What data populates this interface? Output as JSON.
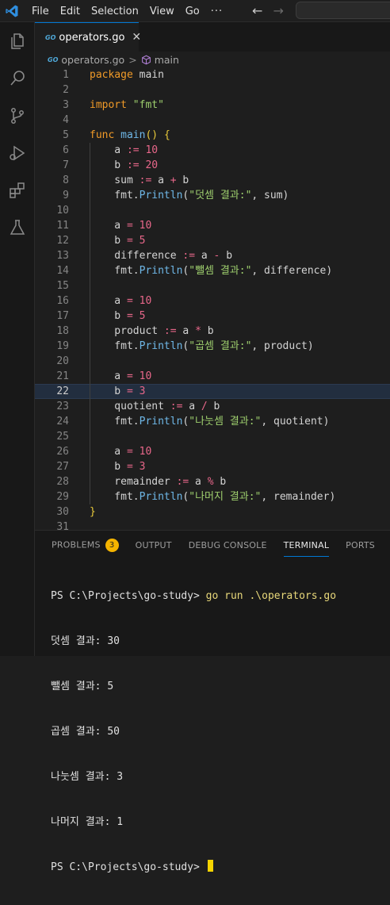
{
  "menu": {
    "items": [
      "File",
      "Edit",
      "Selection",
      "View",
      "Go"
    ],
    "more": "···"
  },
  "nav": {
    "back": "←",
    "forward": "→"
  },
  "tab": {
    "icon": "GO",
    "filename": "operators.go",
    "close": "✕"
  },
  "breadcrumb": {
    "icon": "GO",
    "file": "operators.go",
    "separator": ">",
    "symbol": "main"
  },
  "code": {
    "highlighted_line": 22,
    "lines": [
      {
        "n": "1",
        "tokens": [
          [
            "k",
            "package"
          ],
          [
            "v",
            " "
          ],
          [
            "v",
            "main"
          ]
        ]
      },
      {
        "n": "2",
        "tokens": []
      },
      {
        "n": "3",
        "tokens": [
          [
            "k",
            "import"
          ],
          [
            "v",
            " "
          ],
          [
            "s",
            "\"fmt\""
          ]
        ]
      },
      {
        "n": "4",
        "tokens": []
      },
      {
        "n": "5",
        "tokens": [
          [
            "k",
            "func"
          ],
          [
            "v",
            " "
          ],
          [
            "f",
            "main"
          ],
          [
            "b",
            "()"
          ],
          [
            "v",
            " "
          ],
          [
            "b",
            "{"
          ]
        ]
      },
      {
        "n": "6",
        "tokens": [
          [
            "v",
            "    a "
          ],
          [
            "o",
            ":="
          ],
          [
            "v",
            " "
          ],
          [
            "n",
            "10"
          ]
        ]
      },
      {
        "n": "7",
        "tokens": [
          [
            "v",
            "    b "
          ],
          [
            "o",
            ":="
          ],
          [
            "v",
            " "
          ],
          [
            "n",
            "20"
          ]
        ]
      },
      {
        "n": "8",
        "tokens": [
          [
            "v",
            "    sum "
          ],
          [
            "o",
            ":="
          ],
          [
            "v",
            " a "
          ],
          [
            "o",
            "+"
          ],
          [
            "v",
            " b"
          ]
        ]
      },
      {
        "n": "9",
        "tokens": [
          [
            "v",
            "    fmt."
          ],
          [
            "f",
            "Println"
          ],
          [
            "v",
            "("
          ],
          [
            "s",
            "\"덧셈 결과:\""
          ],
          [
            "v",
            ", sum)"
          ]
        ]
      },
      {
        "n": "10",
        "tokens": []
      },
      {
        "n": "11",
        "tokens": [
          [
            "v",
            "    a "
          ],
          [
            "o",
            "="
          ],
          [
            "v",
            " "
          ],
          [
            "n",
            "10"
          ]
        ]
      },
      {
        "n": "12",
        "tokens": [
          [
            "v",
            "    b "
          ],
          [
            "o",
            "="
          ],
          [
            "v",
            " "
          ],
          [
            "n",
            "5"
          ]
        ]
      },
      {
        "n": "13",
        "tokens": [
          [
            "v",
            "    difference "
          ],
          [
            "o",
            ":="
          ],
          [
            "v",
            " a "
          ],
          [
            "o",
            "-"
          ],
          [
            "v",
            " b"
          ]
        ]
      },
      {
        "n": "14",
        "tokens": [
          [
            "v",
            "    fmt."
          ],
          [
            "f",
            "Println"
          ],
          [
            "v",
            "("
          ],
          [
            "s",
            "\"뺄셈 결과:\""
          ],
          [
            "v",
            ", difference)"
          ]
        ]
      },
      {
        "n": "15",
        "tokens": []
      },
      {
        "n": "16",
        "tokens": [
          [
            "v",
            "    a "
          ],
          [
            "o",
            "="
          ],
          [
            "v",
            " "
          ],
          [
            "n",
            "10"
          ]
        ]
      },
      {
        "n": "17",
        "tokens": [
          [
            "v",
            "    b "
          ],
          [
            "o",
            "="
          ],
          [
            "v",
            " "
          ],
          [
            "n",
            "5"
          ]
        ]
      },
      {
        "n": "18",
        "tokens": [
          [
            "v",
            "    product "
          ],
          [
            "o",
            ":="
          ],
          [
            "v",
            " a "
          ],
          [
            "o",
            "*"
          ],
          [
            "v",
            " b"
          ]
        ]
      },
      {
        "n": "19",
        "tokens": [
          [
            "v",
            "    fmt."
          ],
          [
            "f",
            "Println"
          ],
          [
            "v",
            "("
          ],
          [
            "s",
            "\"곱셈 결과:\""
          ],
          [
            "v",
            ", product)"
          ]
        ]
      },
      {
        "n": "20",
        "tokens": []
      },
      {
        "n": "21",
        "tokens": [
          [
            "v",
            "    a "
          ],
          [
            "o",
            "="
          ],
          [
            "v",
            " "
          ],
          [
            "n",
            "10"
          ]
        ]
      },
      {
        "n": "22",
        "tokens": [
          [
            "v",
            "    b "
          ],
          [
            "o",
            "="
          ],
          [
            "v",
            " "
          ],
          [
            "n",
            "3"
          ]
        ]
      },
      {
        "n": "23",
        "tokens": [
          [
            "v",
            "    quotient "
          ],
          [
            "o",
            ":="
          ],
          [
            "v",
            " a "
          ],
          [
            "o",
            "/"
          ],
          [
            "v",
            " b"
          ]
        ]
      },
      {
        "n": "24",
        "tokens": [
          [
            "v",
            "    fmt."
          ],
          [
            "f",
            "Println"
          ],
          [
            "v",
            "("
          ],
          [
            "s",
            "\"나눗셈 결과:\""
          ],
          [
            "v",
            ", quotient)"
          ]
        ]
      },
      {
        "n": "25",
        "tokens": []
      },
      {
        "n": "26",
        "tokens": [
          [
            "v",
            "    a "
          ],
          [
            "o",
            "="
          ],
          [
            "v",
            " "
          ],
          [
            "n",
            "10"
          ]
        ]
      },
      {
        "n": "27",
        "tokens": [
          [
            "v",
            "    b "
          ],
          [
            "o",
            "="
          ],
          [
            "v",
            " "
          ],
          [
            "n",
            "3"
          ]
        ]
      },
      {
        "n": "28",
        "tokens": [
          [
            "v",
            "    remainder "
          ],
          [
            "o",
            ":="
          ],
          [
            "v",
            " a "
          ],
          [
            "o",
            "%"
          ],
          [
            "v",
            " b"
          ]
        ]
      },
      {
        "n": "29",
        "tokens": [
          [
            "v",
            "    fmt."
          ],
          [
            "f",
            "Println"
          ],
          [
            "v",
            "("
          ],
          [
            "s",
            "\"나머지 결과:\""
          ],
          [
            "v",
            ", remainder)"
          ]
        ]
      },
      {
        "n": "30",
        "tokens": [
          [
            "b",
            "}"
          ]
        ]
      },
      {
        "n": "31",
        "tokens": []
      }
    ]
  },
  "panel": {
    "tabs": [
      {
        "label": "PROBLEMS",
        "badge": "3",
        "active": false
      },
      {
        "label": "OUTPUT",
        "active": false
      },
      {
        "label": "DEBUG CONSOLE",
        "active": false
      },
      {
        "label": "TERMINAL",
        "active": true
      },
      {
        "label": "PORTS",
        "active": false
      }
    ],
    "terminal": {
      "prompt": "PS C:\\Projects\\go-study> ",
      "command": "go run .\\operators.go",
      "output": [
        "덧셈 결과: 30",
        "뺄셈 결과: 5",
        "곱셈 결과: 50",
        "나눗셈 결과: 3",
        "나머지 결과: 1"
      ],
      "final_prompt": "PS C:\\Projects\\go-study> "
    }
  },
  "colors": {
    "accent": "#0078d4",
    "badge": "#f5b400",
    "line_highlight": "#222e3f"
  }
}
